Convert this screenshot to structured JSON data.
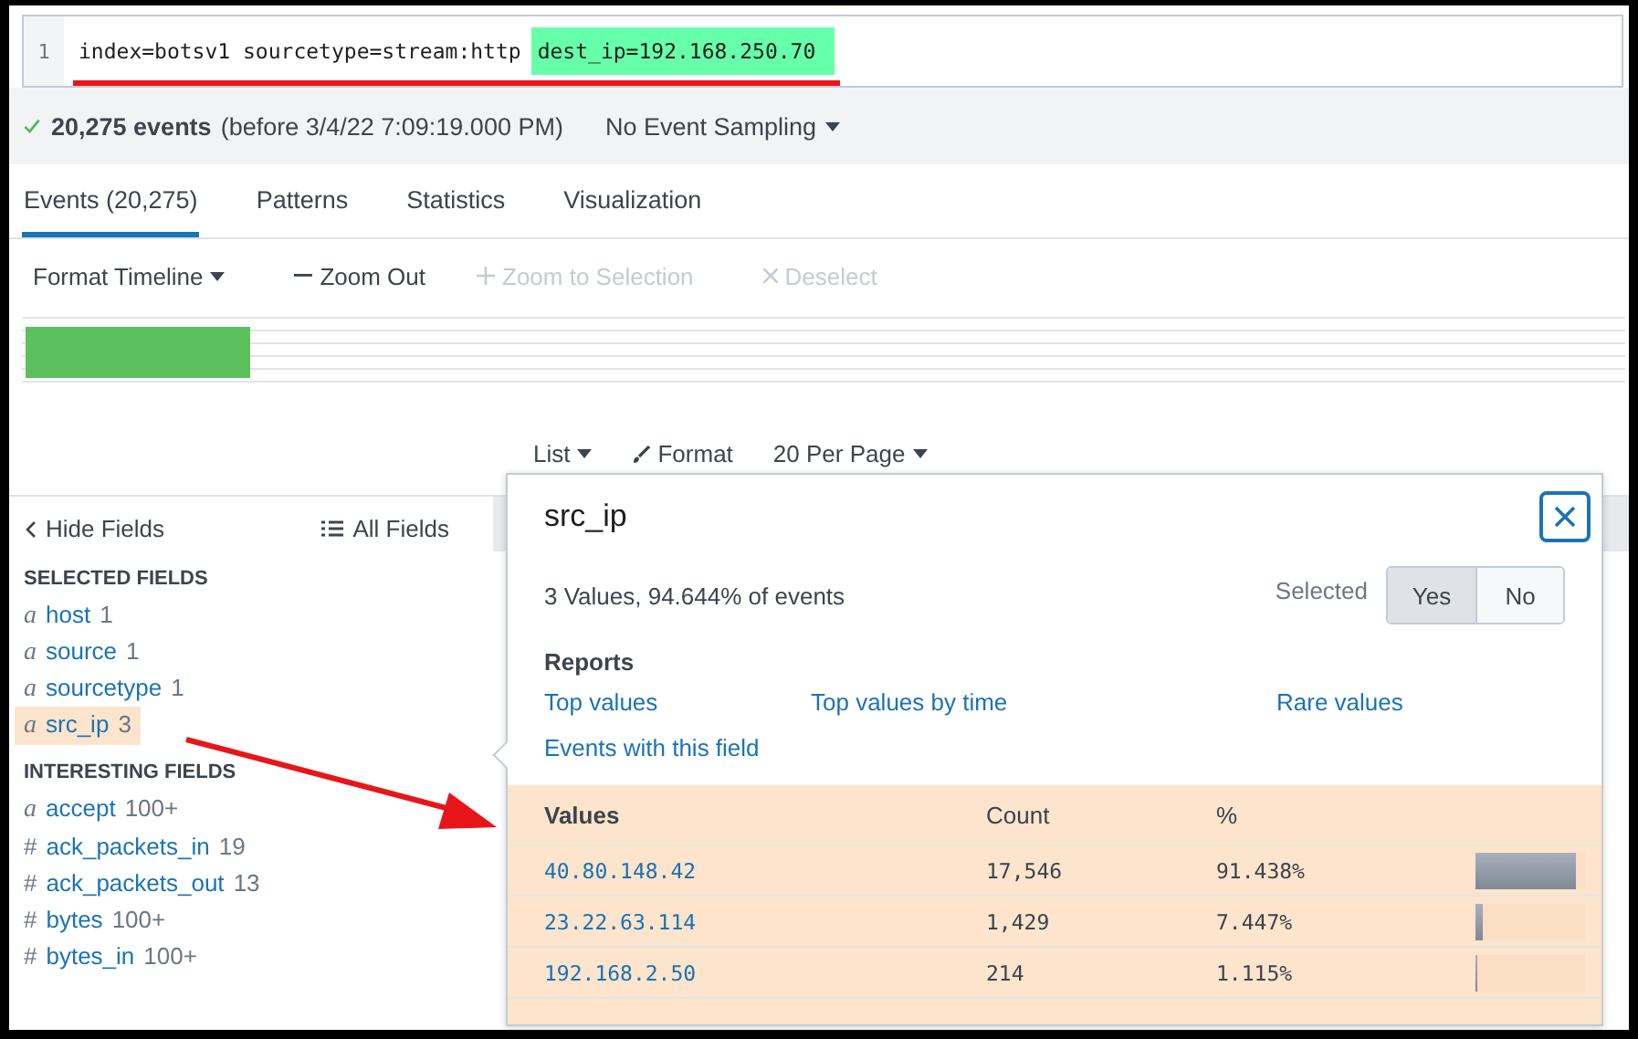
{
  "search": {
    "line_number": "1",
    "query": "index=botsv1 sourcetype=stream:http",
    "highlighted": "dest_ip=192.168.250.70"
  },
  "summary": {
    "event_count": "20,275 events",
    "time_range": "(before 3/4/22 7:09:19.000 PM)",
    "sampling": "No Event Sampling"
  },
  "tabs": [
    {
      "label": "Events (20,275)",
      "selected": true
    },
    {
      "label": "Patterns",
      "selected": false
    },
    {
      "label": "Statistics",
      "selected": false
    },
    {
      "label": "Visualization",
      "selected": false
    }
  ],
  "timeline_toolbar": [
    {
      "label": "Format Timeline",
      "kind": "dropdown",
      "disabled": false
    },
    {
      "label": "Zoom Out",
      "kind": "minus",
      "disabled": false
    },
    {
      "label": "Zoom to Selection",
      "kind": "plus",
      "disabled": true
    },
    {
      "label": "Deselect",
      "kind": "cross",
      "disabled": true
    }
  ],
  "results_toolbar": [
    {
      "label": "List",
      "kind": "dropdown"
    },
    {
      "label": "Format",
      "kind": "brush"
    },
    {
      "label": "20 Per Page",
      "kind": "dropdown"
    }
  ],
  "fields_sidebar": {
    "hide_label": "Hide Fields",
    "all_label": "All Fields",
    "sections": [
      {
        "title": "SELECTED FIELDS",
        "fields": [
          {
            "type_marker": "a",
            "name": "host",
            "count": "1",
            "highlighted": false
          },
          {
            "type_marker": "a",
            "name": "source",
            "count": "1",
            "highlighted": false
          },
          {
            "type_marker": "a",
            "name": "sourcetype",
            "count": "1",
            "highlighted": false
          },
          {
            "type_marker": "a",
            "name": "src_ip",
            "count": "3",
            "highlighted": true
          }
        ]
      },
      {
        "title": "INTERESTING FIELDS",
        "fields": [
          {
            "type_marker": "a",
            "name": "accept",
            "count": "100+",
            "highlighted": false
          },
          {
            "type_marker": "#",
            "name": "ack_packets_in",
            "count": "19",
            "highlighted": false
          },
          {
            "type_marker": "#",
            "name": "ack_packets_out",
            "count": "13",
            "highlighted": false
          },
          {
            "type_marker": "#",
            "name": "bytes",
            "count": "100+",
            "highlighted": false
          },
          {
            "type_marker": "#",
            "name": "bytes_in",
            "count": "100+",
            "highlighted": false
          }
        ]
      }
    ]
  },
  "field_popup": {
    "title": "src_ip",
    "summary": "3 Values, 94.644% of events",
    "selected_label": "Selected",
    "options": [
      {
        "label": "Yes",
        "selected": true
      },
      {
        "label": "No",
        "selected": false
      }
    ],
    "reports_title": "Reports",
    "reports": [
      "Top values",
      "Top values by time",
      "Rare values",
      "Events with this field"
    ],
    "table": {
      "columns": [
        "Values",
        "Count",
        "%"
      ],
      "rows": [
        {
          "value": "40.80.148.42",
          "count": "17,546",
          "percent": "91.438%",
          "level": 0.91438
        },
        {
          "value": "23.22.63.114",
          "count": "1,429",
          "percent": "7.447%",
          "level": 0.07447
        },
        {
          "value": "192.168.2.50",
          "count": "214",
          "percent": "1.115%",
          "level": 0.01115
        }
      ]
    }
  }
}
